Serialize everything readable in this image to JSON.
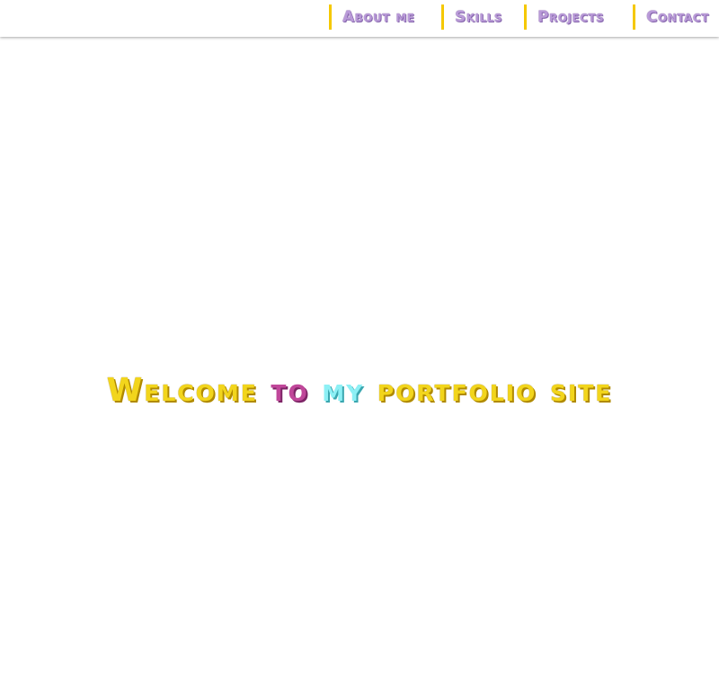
{
  "nav": {
    "items": [
      {
        "label": "About me"
      },
      {
        "label": "Skills"
      },
      {
        "label": "Projects"
      },
      {
        "label": "Contact"
      }
    ]
  },
  "hero": {
    "word1": "Welcome",
    "word2": "to",
    "word3": "my",
    "word4": "portfolio",
    "word5": "site"
  },
  "colors": {
    "nav_text": "#b99ad8",
    "nav_divider": "#f5c800",
    "hero_yellow": "#f2d51c",
    "hero_pink": "#c0479a",
    "hero_cyan": "#8df0f5"
  }
}
